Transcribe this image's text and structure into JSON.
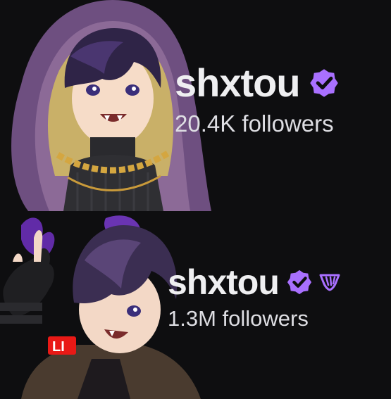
{
  "profiles": [
    {
      "name": "shxtou",
      "followers": "20.4K followers",
      "verified_icon": "verified-badge-icon"
    },
    {
      "name": "shxtou",
      "followers": "1.3M followers",
      "verified_icon": "verified-badge-icon",
      "extra_icon": "partner-cup-icon",
      "live_indicator": "LI"
    }
  ],
  "colors": {
    "background": "#0e0e10",
    "text": "#efeff1",
    "badge": "#a970ff",
    "hood": "#7b5a8a",
    "hair": "#3b2a55"
  }
}
